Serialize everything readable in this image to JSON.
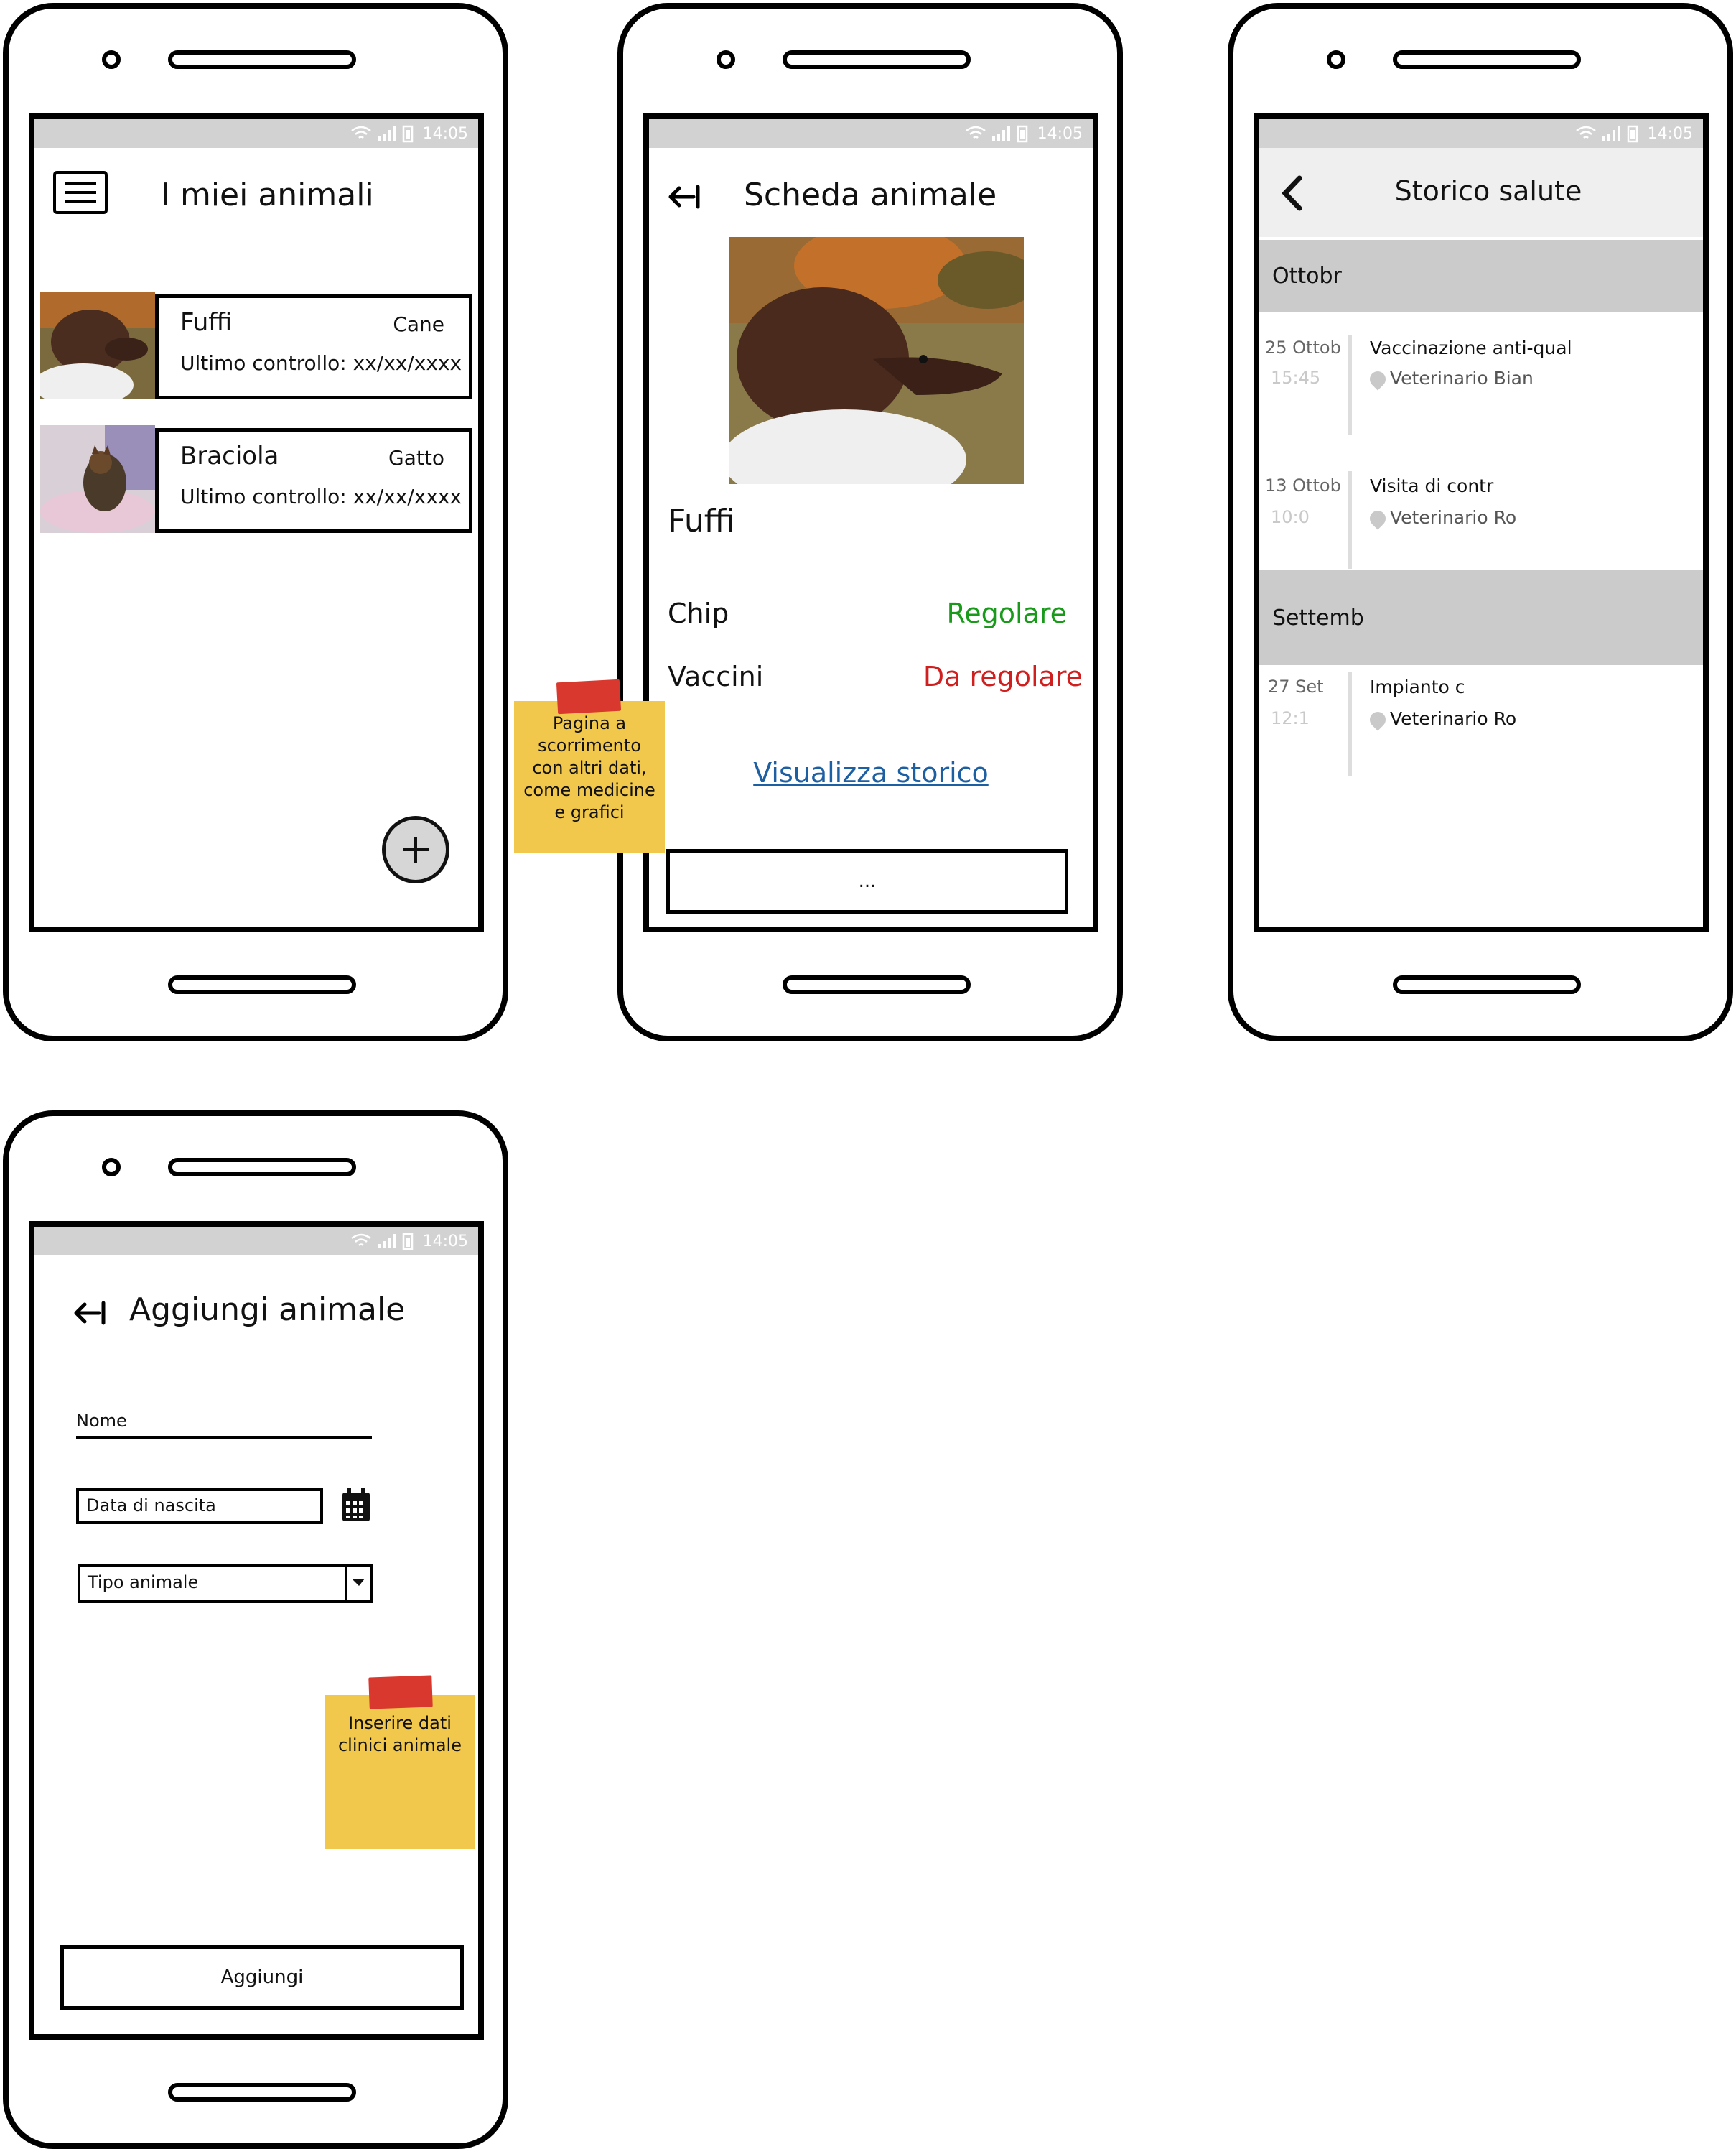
{
  "status_bar": {
    "time": "14:05"
  },
  "screen_list": {
    "title": "I miei animali",
    "pets": [
      {
        "name": "Fuffi",
        "type": "Cane",
        "last_check": "Ultimo controllo: xx/xx/xxxx"
      },
      {
        "name": "Braciola",
        "type": "Gatto",
        "last_check": "Ultimo controllo: xx/xx/xxxx"
      }
    ],
    "fab_icon": "plus-icon",
    "menu_icon": "hamburger-menu-icon"
  },
  "screen_detail": {
    "title": "Scheda animale",
    "pet_name": "Fuffi",
    "rows": [
      {
        "label": "Chip",
        "value": "Regolare",
        "color": "#1a9a1a"
      },
      {
        "label": "Vaccini",
        "value": "Da regolare",
        "color": "#d01f1f"
      }
    ],
    "history_link": "Visualizza storico",
    "more_button": "...",
    "note": "Pagina a scorrimento con altri dati, come medicine e grafici"
  },
  "screen_history": {
    "title": "Storico salute",
    "months": [
      {
        "name": "Ottobr",
        "events": [
          {
            "date": "25 Ottob",
            "time": "15:45",
            "title": "Vaccinazione anti-qual",
            "place": "Veterinario Bian"
          },
          {
            "date": "13 Ottob",
            "time": "10:0",
            "title": "Visita di contr",
            "place": "Veterinario Ro"
          }
        ]
      },
      {
        "name": "Settemb",
        "events": [
          {
            "date": "27 Set",
            "time": "12:1",
            "title": "Impianto c",
            "place": "Veterinario Ro"
          }
        ]
      }
    ]
  },
  "screen_add": {
    "title": "Aggiungi animale",
    "name_label": "Nome",
    "birth_placeholder": "Data di nascita",
    "type_placeholder": "Tipo animale",
    "submit": "Aggiungi",
    "note": "Inserire dati clinici animale"
  },
  "colors": {
    "status_bar": "#d2d2d2",
    "note": "#f1c84b",
    "tape": "#d8382e",
    "link": "#1d5fa3"
  }
}
